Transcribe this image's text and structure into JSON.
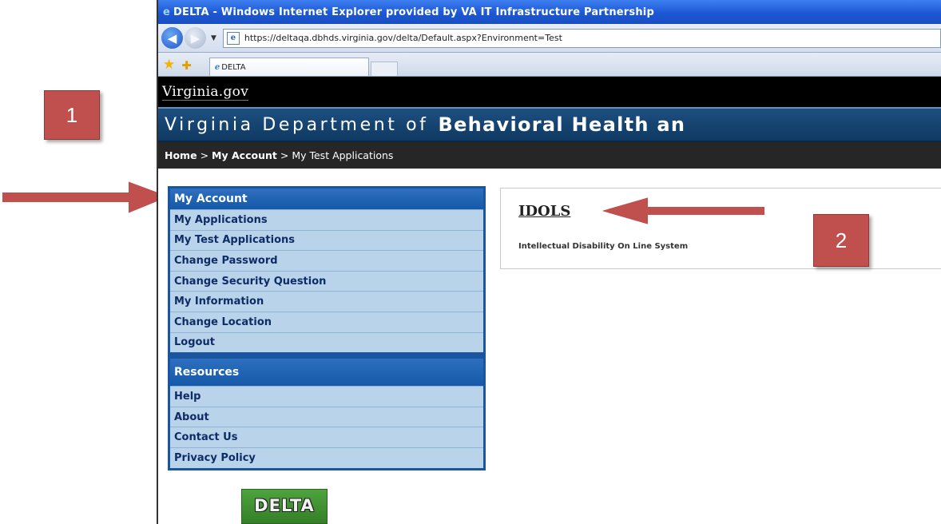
{
  "callouts": {
    "one": "1",
    "two": "2"
  },
  "colors": {
    "callout": "#c0504d",
    "titlebar": "#1c57d4",
    "sidebar": "#1a56a0",
    "sidebar_item_bg": "#b9d3ea",
    "banner": "#0f3a63"
  },
  "browser": {
    "title": "DELTA - Windows Internet Explorer provided by VA IT Infrastructure Partnership",
    "url": "https://deltaqa.dbhds.virginia.gov/delta/Default.aspx?Environment=Test",
    "tab_label": "DELTA",
    "icons": [
      "ie-icon",
      "back-icon",
      "forward-icon",
      "dropdown-icon",
      "page-icon",
      "favorites-star-icon",
      "add-favorites-icon",
      "tab-ie-icon"
    ]
  },
  "header": {
    "logo": "Virginia.gov",
    "dept_prefix": "Virginia  Department  of",
    "dept_bold": "Behavioral Health an"
  },
  "breadcrumb": {
    "home": "Home",
    "sep1": ">",
    "account": "My Account",
    "sep2": ">",
    "current": "My Test Applications"
  },
  "sidebar": {
    "account_title": "My Account",
    "account_items": [
      {
        "label": "My Applications"
      },
      {
        "label": "My Test Applications"
      },
      {
        "label": "Change Password"
      },
      {
        "label": "Change Security Question"
      },
      {
        "label": "My Information"
      },
      {
        "label": "Change Location"
      },
      {
        "label": "Logout"
      }
    ],
    "resources_title": "Resources",
    "resources_items": [
      {
        "label": "Help"
      },
      {
        "label": "About"
      },
      {
        "label": "Contact Us"
      },
      {
        "label": "Privacy Policy"
      }
    ]
  },
  "logo_text": "DELTA",
  "app": {
    "title": "IDOLS",
    "description": "Intellectual Disability On Line System"
  }
}
